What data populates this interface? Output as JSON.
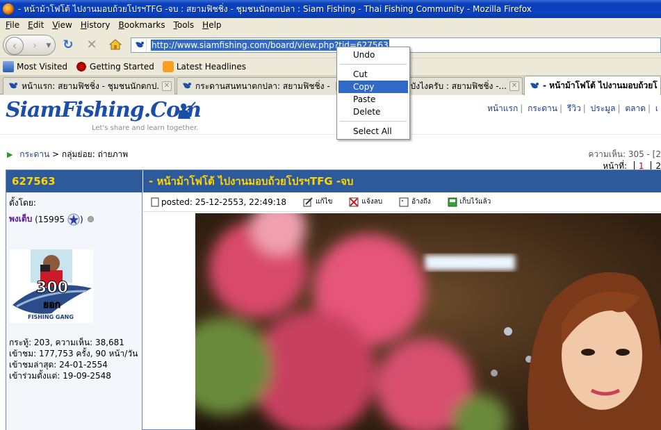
{
  "window": {
    "title": "- หน้าม้าโฟโต้ ไปงานมอบถ้วยโปรฯTFG -จบ : สยามฟิชชิ่ง - ชุมชนนักตกปลา : Siam Fishing - Thai Fishing Community - Mozilla Firefox"
  },
  "menubar": [
    "File",
    "Edit",
    "View",
    "History",
    "Bookmarks",
    "Tools",
    "Help"
  ],
  "navbar": {
    "url": "http://www.siamfishing.com/board/view.php?tid=627563"
  },
  "bookmarks": [
    {
      "label": "Most Visited",
      "icon": "most-visited-icon"
    },
    {
      "label": "Getting Started",
      "icon": "getting-started-icon"
    },
    {
      "label": "Latest Headlines",
      "icon": "rss-feed-icon"
    }
  ],
  "tabs": [
    {
      "label": "หน้าแรก: สยามฟิชชิ่ง - ชุมชนนักตกป..."
    },
    {
      "label": "กระดานสนทนาตกปลา: สยามฟิชชิ่ง - ..."
    },
    {
      "label": "าบังไงครับ : สยามฟิชชิ่ง -..."
    },
    {
      "label": "- หน้าม้าโฟโต้ ไปงานมอบถ้วยโป"
    }
  ],
  "context_menu": {
    "items": [
      "Undo",
      "Cut",
      "Copy",
      "Paste",
      "Delete",
      "Select All"
    ],
    "highlighted": "Copy"
  },
  "site": {
    "brand": "SiamFishing.Com",
    "tagline": "Let's share and learn together.",
    "topnav": [
      "หน้าแรก",
      "กระดาน",
      "รีวิว",
      "ประมูล",
      "ตลาด",
      "เ"
    ]
  },
  "breadcrumb": {
    "root": "กระดาน",
    "sep": ">",
    "current": "กลุ่มย่อย: ถ่ายภาพ"
  },
  "thread_stats": "ความเห็น: 305 - [2",
  "pager": {
    "label": "หน้าที่:",
    "current": "1",
    "next": "2"
  },
  "post": {
    "id": "627563",
    "title": "- หน้าม้าโฟโต้ ไปงานมอบถ้วยโปรฯTFG -จบ",
    "posted_by_label": "ตั้งโดย:",
    "poster_name": "พงเต็บ",
    "poster_points": "(15995",
    "poster_points_close": ")",
    "avatar_text_top": "300",
    "avatar_text_mid": "ยอก",
    "avatar_caption": "FISHING GANG",
    "user_stats": [
      "กระทู้: 203, ความเห็น: 38,681",
      "เข้าชม: 177,753 ครั้ง, 90 หน้า/วัน",
      "เข้าชมล่าสุด: 24-01-2554",
      "เข้าร่วมตั้งแต่: 19-09-2548"
    ],
    "posted": "posted: 25-12-2553, 22:49:18",
    "actions": [
      "แก้ไข",
      "แจ้งลบ",
      "อ้างถึง",
      "เก็บไว้แล้ว"
    ]
  },
  "colors": {
    "title_bar": "#0b43c4",
    "post_header_bg": "#2d5a9a",
    "post_header_text": "#ffd400",
    "selection": "#316ac5",
    "link": "#1a3d8f"
  }
}
